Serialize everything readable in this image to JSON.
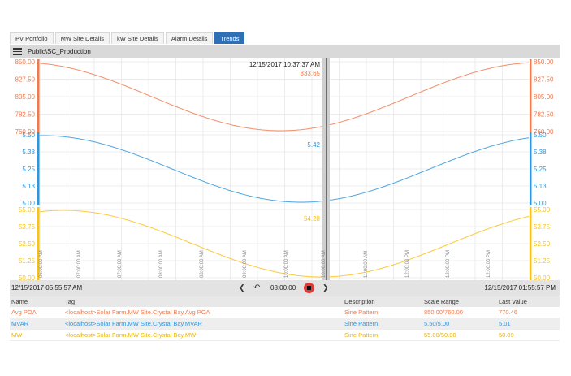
{
  "tabs": [
    {
      "label": "PV Portfolio",
      "active": false
    },
    {
      "label": "MW Site Details",
      "active": false
    },
    {
      "label": "kW Site Details",
      "active": false
    },
    {
      "label": "Alarm Details",
      "active": false
    },
    {
      "label": "Trends",
      "active": true
    }
  ],
  "header": {
    "path": "Public\\SC_Production"
  },
  "chart": {
    "cursor_timestamp": "12/15/2017 10:37:37 AM",
    "time_ticks": [
      "06:00:00 AM",
      "07:00:00 AM",
      "07:00:00 AM",
      "08:00:00 AM",
      "08:00:00 AM",
      "09:00:00 AM",
      "10:00:00 AM",
      "10:00:00 AM",
      "11:00:00 AM",
      "12:00:00 PM",
      "12:00:00 PM",
      "12:00:00 PM"
    ],
    "axes": [
      {
        "color": "#ef7a4d",
        "ticks": [
          "850.00",
          "827.50",
          "805.00",
          "782.50",
          "760.00"
        ],
        "cursor_value": "833.65"
      },
      {
        "color": "#2f96dc",
        "ticks": [
          "5.50",
          "5.38",
          "5.25",
          "5.13",
          "5.00"
        ],
        "cursor_value": "5.42"
      },
      {
        "color": "#f7c21b",
        "ticks": [
          "55.00",
          "53.75",
          "52.50",
          "51.25",
          "50.00"
        ],
        "cursor_value": "54.28"
      }
    ]
  },
  "timebar": {
    "start": "12/15/2017 05:55:57 AM",
    "end": "12/15/2017 01:55:57 PM",
    "duration": "08:00:00",
    "prev_icon": "chevron-left-icon",
    "next_icon": "chevron-right-icon",
    "undo_icon": "undo-icon",
    "stop_icon": "stop-icon"
  },
  "legend": {
    "headers": {
      "name": "Name",
      "tag": "Tag",
      "description": "Description",
      "range": "Scale Range",
      "last": "Last Value"
    },
    "rows": [
      {
        "name": "Avg POA",
        "tag": "<localhost>Solar Farm.MW Site.Crystal Bay.Avg POA",
        "description": "Sine Pattern",
        "range": "850.00/760.00",
        "last": "770.46",
        "color": "#ef7a4d"
      },
      {
        "name": "MVAR",
        "tag": "<localhost>Solar Farm.MW Site.Crystal Bay.MVAR",
        "description": "Sine Pattern",
        "range": "5.50/5.00",
        "last": "5.01",
        "color": "#2f96dc"
      },
      {
        "name": "MW",
        "tag": "<localhost>Solar Farm.MW Site.Crystal Bay.MW",
        "description": "Sine Pattern",
        "range": "55.00/50.00",
        "last": "50.09",
        "color": "#f7c21b"
      }
    ]
  }
}
